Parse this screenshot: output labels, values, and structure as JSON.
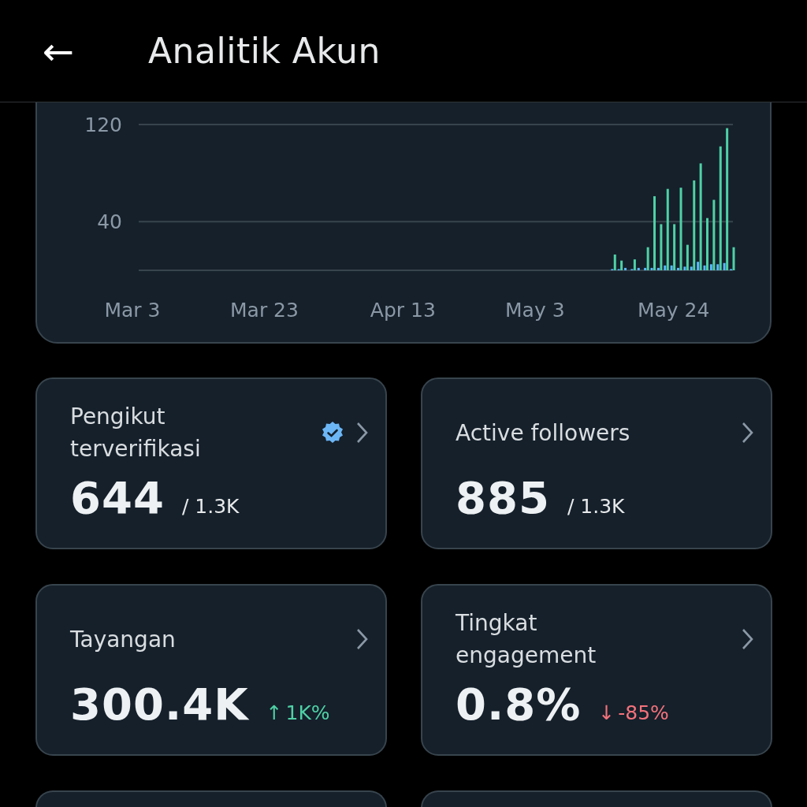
{
  "header": {
    "back": "←",
    "title": "Analitik Akun"
  },
  "chart": {
    "chart_data": {
      "type": "bar",
      "categories": [
        "Mar 3",
        null,
        null,
        null,
        null,
        null,
        null,
        null,
        null,
        null,
        null,
        null,
        null,
        null,
        null,
        null,
        null,
        null,
        null,
        null,
        "Mar 23",
        null,
        null,
        null,
        null,
        null,
        null,
        null,
        null,
        null,
        null,
        null,
        null,
        null,
        null,
        null,
        null,
        null,
        null,
        null,
        null,
        "Apr 13",
        null,
        null,
        null,
        null,
        null,
        null,
        null,
        null,
        null,
        null,
        null,
        null,
        null,
        null,
        null,
        null,
        null,
        null,
        null,
        "May 3",
        null,
        null,
        null,
        null,
        null,
        null,
        null,
        null,
        null,
        null,
        null,
        null,
        null,
        null,
        null,
        null,
        null,
        null,
        null,
        null,
        "May 24",
        null,
        null,
        null,
        null,
        null,
        null,
        null,
        null,
        null
      ],
      "series": [
        {
          "color": "#5ab8ff",
          "values": [
            null,
            null,
            null,
            null,
            null,
            null,
            null,
            null,
            null,
            null,
            null,
            null,
            null,
            null,
            null,
            null,
            null,
            null,
            null,
            null,
            null,
            null,
            null,
            null,
            null,
            null,
            null,
            null,
            null,
            null,
            null,
            null,
            null,
            null,
            null,
            null,
            null,
            null,
            null,
            null,
            null,
            null,
            null,
            null,
            null,
            null,
            null,
            null,
            null,
            null,
            null,
            null,
            null,
            null,
            null,
            null,
            null,
            null,
            null,
            null,
            null,
            null,
            null,
            null,
            null,
            null,
            null,
            null,
            null,
            null,
            null,
            null,
            null,
            1,
            1,
            2,
            1,
            2,
            2,
            2,
            2,
            4,
            4,
            2,
            3,
            3,
            7,
            4,
            5,
            5,
            6,
            1
          ]
        },
        {
          "color": "#4fd1a5",
          "values": [
            null,
            null,
            null,
            null,
            null,
            null,
            null,
            null,
            null,
            null,
            null,
            null,
            null,
            null,
            null,
            null,
            null,
            null,
            null,
            null,
            null,
            null,
            null,
            null,
            null,
            null,
            null,
            null,
            null,
            null,
            null,
            null,
            null,
            null,
            null,
            null,
            null,
            null,
            null,
            null,
            null,
            null,
            null,
            null,
            null,
            null,
            null,
            null,
            null,
            null,
            null,
            null,
            null,
            null,
            null,
            null,
            null,
            null,
            null,
            null,
            null,
            null,
            null,
            null,
            null,
            null,
            null,
            null,
            null,
            null,
            null,
            null,
            null,
            13,
            8,
            0,
            9,
            0,
            19,
            61,
            38,
            67,
            38,
            68,
            21,
            74,
            88,
            43,
            58,
            102,
            117,
            19
          ]
        }
      ],
      "ylim": [
        0,
        120
      ],
      "yticks": [
        40,
        120
      ]
    }
  },
  "cards": [
    {
      "kind": "stat",
      "title": "Pengikut terverifikasi",
      "verified": true,
      "value": "644",
      "total": "/ 1.3K"
    },
    {
      "kind": "stat",
      "title": "Active followers",
      "verified": false,
      "value": "885",
      "total": "/ 1.3K"
    },
    {
      "kind": "stat",
      "title": "Tayangan",
      "verified": false,
      "value": "300.4K",
      "change": {
        "kind": "increase",
        "arrow": "↑",
        "text": "1K%"
      }
    },
    {
      "kind": "stat",
      "title": "Tingkat engagement",
      "verified": false,
      "value": "0.8%",
      "change": {
        "kind": "decrease",
        "arrow": "↓",
        "text": "-85%"
      }
    },
    {
      "kind": "partial"
    },
    {
      "kind": "partial"
    }
  ]
}
